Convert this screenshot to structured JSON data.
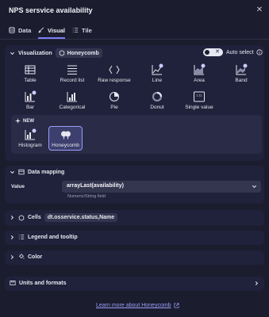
{
  "header": {
    "title": "NPS sersvice availability",
    "close_label": "✕"
  },
  "tabs": [
    {
      "label": "Data",
      "icon": "database-icon"
    },
    {
      "label": "Visual",
      "icon": "brush-icon"
    },
    {
      "label": "Tile",
      "icon": "list-icon"
    }
  ],
  "visualization": {
    "label": "Visualization",
    "current": "Honeycomb",
    "auto_select_label": "Auto select",
    "auto_select_on": true,
    "items": [
      {
        "label": "Table",
        "icon": "table-icon"
      },
      {
        "label": "Record list",
        "icon": "record-list-icon"
      },
      {
        "label": "Raw response",
        "icon": "raw-response-icon"
      },
      {
        "label": "Line",
        "icon": "line-chart-icon"
      },
      {
        "label": "Area",
        "icon": "area-chart-icon"
      },
      {
        "label": "Band",
        "icon": "band-chart-icon"
      },
      {
        "label": "Bar",
        "icon": "bar-chart-icon"
      },
      {
        "label": "Categorical",
        "icon": "categorical-chart-icon"
      },
      {
        "label": "Pie",
        "icon": "pie-chart-icon"
      },
      {
        "label": "Donut",
        "icon": "donut-chart-icon"
      },
      {
        "label": "Single value",
        "icon": "single-value-icon",
        "sample": "1.11"
      }
    ],
    "new_label": "NEW",
    "new_items": [
      {
        "label": "Histogram",
        "icon": "histogram-icon"
      },
      {
        "label": "Honeycomb",
        "icon": "honeycomb-icon",
        "selected": true
      }
    ]
  },
  "data_mapping": {
    "label": "Data mapping",
    "value_label": "Value",
    "value": "arrayLast(availability)",
    "hint": "Numeric/String field"
  },
  "cells": {
    "label": "Cells",
    "value": "dt.osservice.status,Name"
  },
  "legend": {
    "label": "Legend and tooltip"
  },
  "color": {
    "label": "Color"
  },
  "units": {
    "label": "Units and formats"
  },
  "learn_more": "Learn more about Honeycomb",
  "colors": {
    "bg": "#1b1c2e",
    "panel": "#20213a",
    "accent": "#7c7ff3"
  }
}
